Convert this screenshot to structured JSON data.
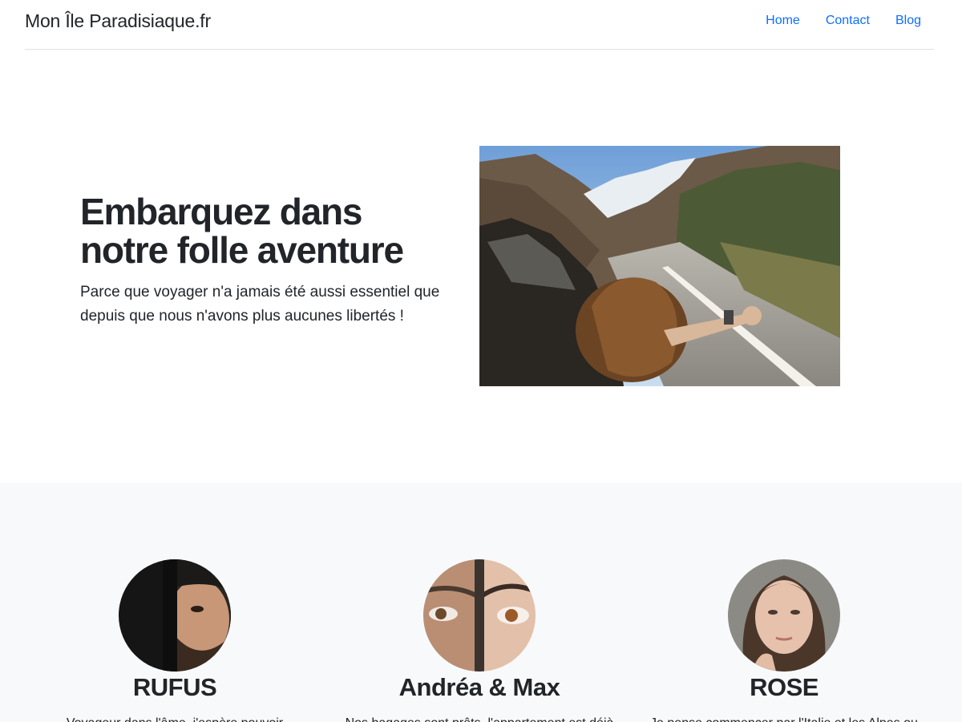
{
  "header": {
    "brand": "Mon Île Paradisiaque.fr",
    "nav": [
      "Home",
      "Contact",
      "Blog"
    ]
  },
  "hero": {
    "title": "Embarquez dans notre folle aventure",
    "lead": "Parce que voyager n'a jamais été aussi essentiel que depuis que nous n'avons plus aucunes libertés !"
  },
  "team": [
    {
      "name": "RUFUS",
      "text": "Voyageur dans l'âme, j'espère pouvoir"
    },
    {
      "name": "Andréa & Max",
      "text": "Nos bagages sont prêts, l'appartement est déjà"
    },
    {
      "name": "ROSE",
      "text": "Je pense commencer par l'Italie et les Alpes ou"
    }
  ],
  "colors": {
    "link": "#0d6efd",
    "text": "#212529",
    "section_bg": "#f8f9fa",
    "divider": "#dee2e6"
  }
}
